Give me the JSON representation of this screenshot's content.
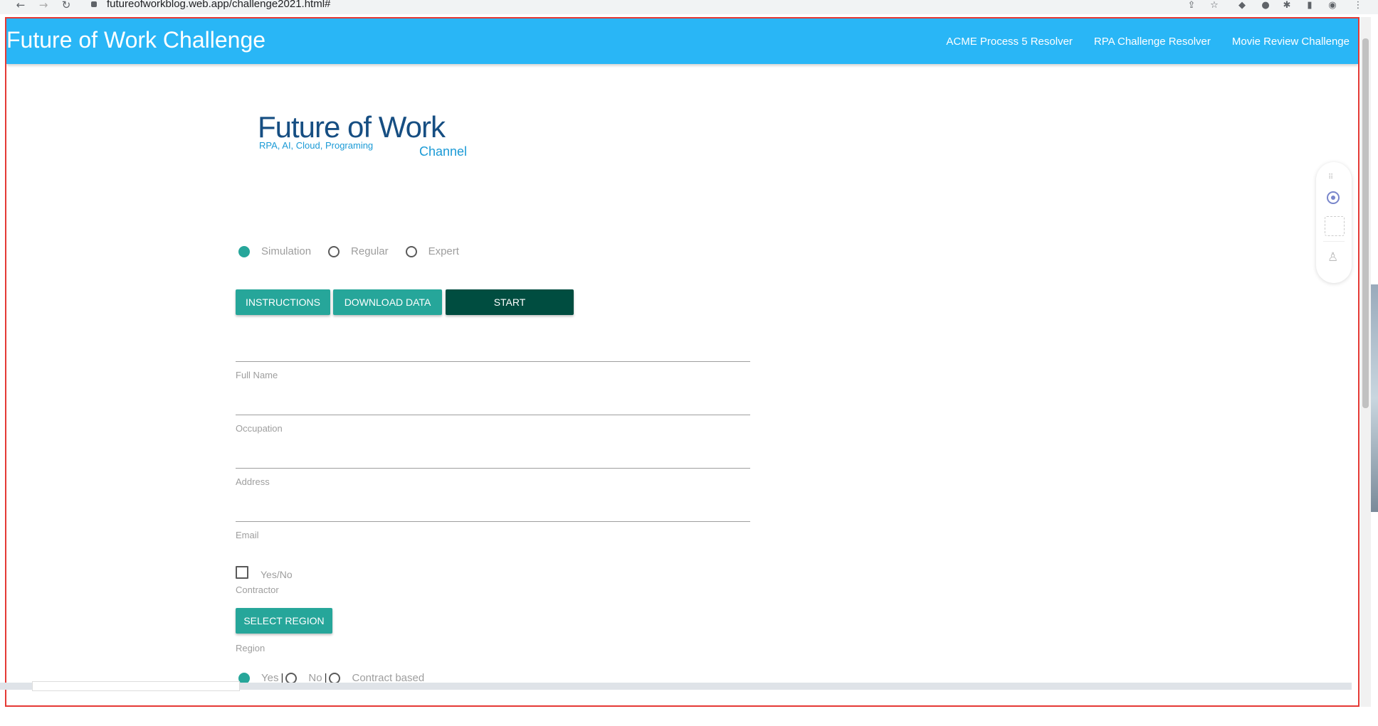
{
  "browser": {
    "url": "futureofworkblog.web.app/challenge2021.html#"
  },
  "app": {
    "title": "Future of Work Challenge",
    "nav": [
      "ACME Process 5 Resolver",
      "RPA Challenge Resolver",
      "Movie Review Challenge"
    ]
  },
  "logo": {
    "main": "Future of Work",
    "sub": "RPA, AI, Cloud, Programing",
    "channel": "Channel"
  },
  "mode": {
    "options": [
      "Simulation",
      "Regular",
      "Expert"
    ],
    "selected": "Simulation"
  },
  "buttons": {
    "instructions": "INSTRUCTIONS",
    "download": "DOWNLOAD DATA",
    "start": "START",
    "select_region": "SELECT REGION"
  },
  "form": {
    "full_name_label": "Full Name",
    "occupation_label": "Occupation",
    "address_label": "Address",
    "email_label": "Email",
    "contractor_checkbox_label": "Yes/No",
    "contractor_label": "Contractor",
    "region_label": "Region"
  },
  "contract": {
    "options": [
      "Yes",
      "No",
      "Contract based"
    ],
    "selected": "Yes"
  },
  "colors": {
    "appbar": "#29b6f6",
    "teal": "#26a69a",
    "dark_teal": "#004d40",
    "frame_border": "#e53935"
  }
}
